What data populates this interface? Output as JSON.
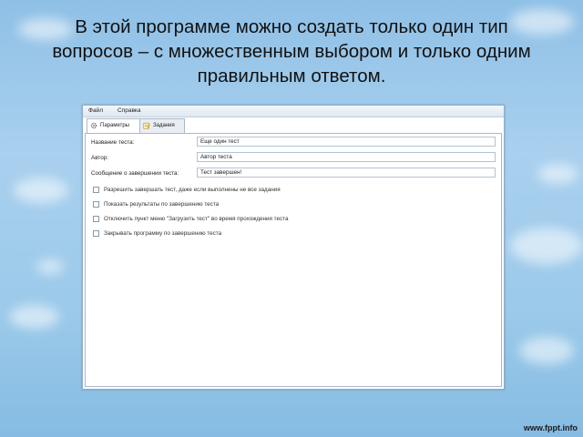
{
  "slide": {
    "heading_lines": [
      "В этой программе можно создать только один тип",
      "вопросов – с множественным выбором и только одним",
      "правильным ответом."
    ],
    "watermark": "www.fppt.info"
  },
  "app": {
    "menu": [
      "Файл",
      "Справка"
    ],
    "tabs": [
      {
        "label": "Параметры",
        "icon": "gear-icon",
        "active": true
      },
      {
        "label": "Задания",
        "icon": "notepad-icon",
        "active": false
      }
    ],
    "fields": [
      {
        "label": "Название теста:",
        "value": "Еще один тест"
      },
      {
        "label": "Автор:",
        "value": "Автор теста"
      },
      {
        "label": "Сообщение о завершении теста:",
        "value": "Тест завершен!"
      }
    ],
    "checkboxes": [
      {
        "label": "Разрешить завершать тест, даже если выполнены не все задания",
        "checked": false
      },
      {
        "label": "Показать результаты по завершению теста",
        "checked": false
      },
      {
        "label": "Отключить пункт меню \"Загрузить тест\" во время прохождения теста",
        "checked": false
      },
      {
        "label": "Закрывать программу по завершению теста",
        "checked": false
      }
    ]
  }
}
